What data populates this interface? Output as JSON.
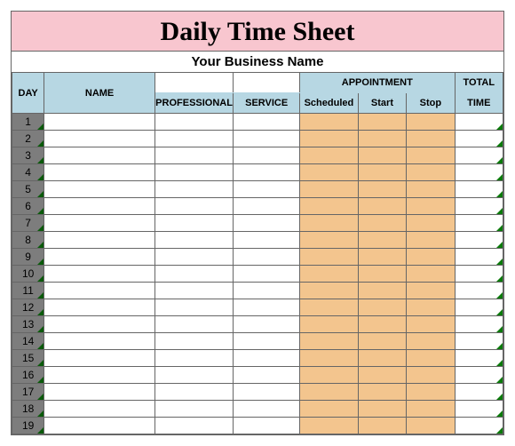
{
  "title": "Daily Time Sheet",
  "subtitle": "Your Business Name",
  "headers": {
    "day": "DAY",
    "name": "NAME",
    "professional": "PROFESSIONAL",
    "service": "SERVICE",
    "appointment": "APPOINTMENT",
    "scheduled": "Scheduled",
    "start": "Start",
    "stop": "Stop",
    "total": "TOTAL",
    "time": "TIME"
  },
  "rows": [
    {
      "day": 1
    },
    {
      "day": 2
    },
    {
      "day": 3
    },
    {
      "day": 4
    },
    {
      "day": 5
    },
    {
      "day": 6
    },
    {
      "day": 7
    },
    {
      "day": 8
    },
    {
      "day": 9
    },
    {
      "day": 10
    },
    {
      "day": 11
    },
    {
      "day": 12
    },
    {
      "day": 13
    },
    {
      "day": 14
    },
    {
      "day": 15
    },
    {
      "day": 16
    },
    {
      "day": 17
    },
    {
      "day": 18
    },
    {
      "day": 19
    }
  ]
}
